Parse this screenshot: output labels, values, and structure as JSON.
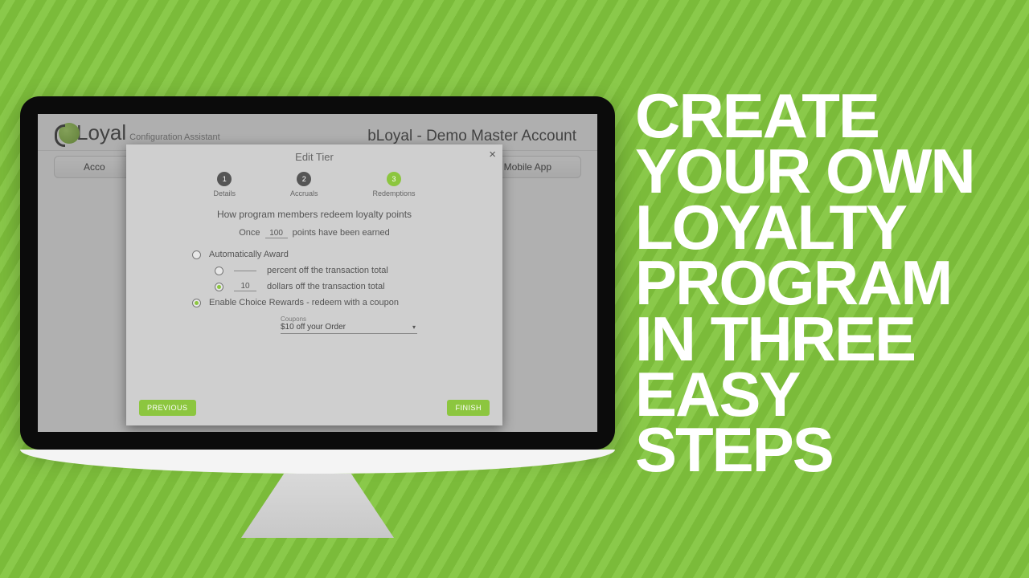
{
  "hero": {
    "line1": "CREATE",
    "line2": "YOUR OWN",
    "line3": "LOYALTY",
    "line4": "PROGRAM",
    "line5": "IN THREE",
    "line6": "EASY STEPS"
  },
  "app": {
    "logo_text": "Loyal",
    "logo_sub": "Configuration Assistant",
    "account_title": "bLoyal - Demo Master Account",
    "tab_left": "Acco",
    "tab_right": "Mobile App"
  },
  "modal": {
    "title": "Edit Tier",
    "close": "×",
    "steps": [
      {
        "num": "1",
        "label": "Details"
      },
      {
        "num": "2",
        "label": "Accruals"
      },
      {
        "num": "3",
        "label": "Redemptions"
      }
    ],
    "section_title": "How program members redeem loyalty points",
    "once_prefix": "Once",
    "points_value": "100",
    "once_suffix": "points have been earned",
    "opt_auto": "Automatically Award",
    "opt_percent_suffix": "percent off the transaction total",
    "opt_dollars_value": "10",
    "opt_dollars_suffix": "dollars off the transaction total",
    "opt_choice": "Enable Choice Rewards - redeem with a coupon",
    "dropdown_label": "Coupons",
    "dropdown_value": "$10 off your Order",
    "btn_prev": "PREVIOUS",
    "btn_finish": "FINISH"
  }
}
